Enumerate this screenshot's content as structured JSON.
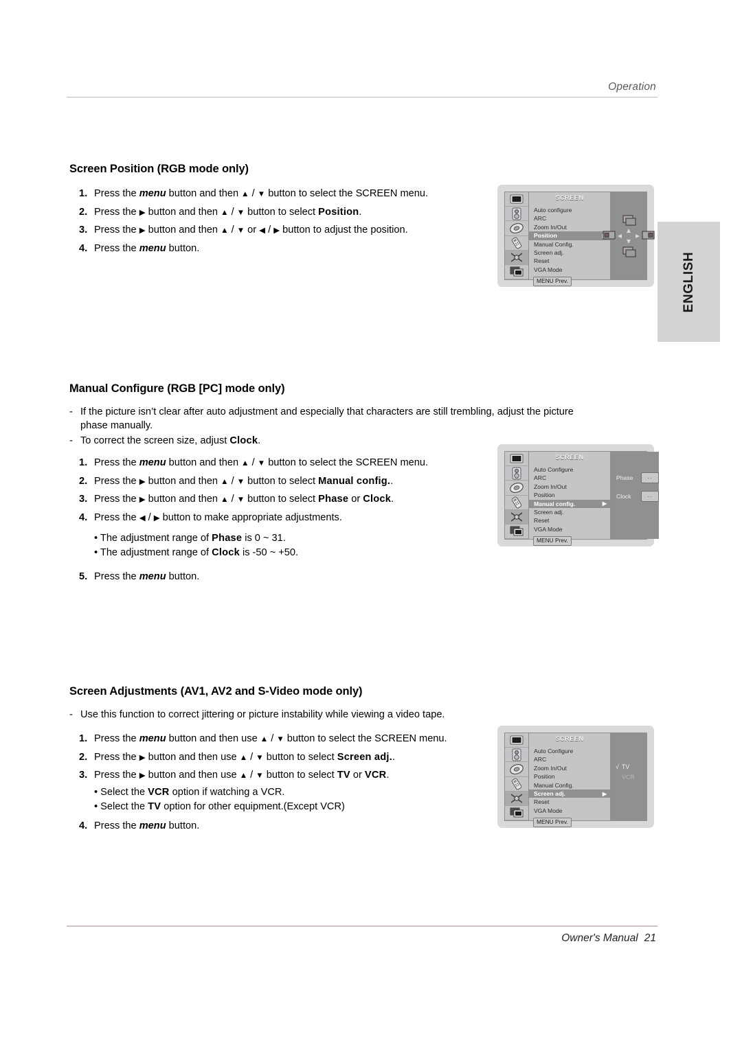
{
  "header": {
    "title": "Operation"
  },
  "side_tab": {
    "label": "ENGLISH"
  },
  "footer": {
    "label": "Owner's Manual",
    "page": "21"
  },
  "sections": [
    {
      "title": "Screen Position (RGB mode only)",
      "steps": [
        {
          "num": "1.",
          "text": "Press the menu button and then ▲ / ▼ button to select the SCREEN menu."
        },
        {
          "num": "2.",
          "text": "Press the ▶ button and then ▲ / ▼ button to select Position."
        },
        {
          "num": "3.",
          "text": "Press the ▶ button and then ▲ / ▼ or ◀ / ▶ button to adjust the position."
        },
        {
          "num": "4.",
          "text": "Press the menu button."
        }
      ]
    },
    {
      "title": "Manual Configure (RGB [PC] mode only)",
      "dashes": [
        "If the picture isn’t clear after auto adjustment and especially that characters are still trembling, adjust the picture phase manually.",
        "To correct the screen size, adjust Clock."
      ],
      "steps": [
        {
          "num": "1.",
          "text": "Press the menu button and then ▲ / ▼ button to select the SCREEN menu."
        },
        {
          "num": "2.",
          "text": "Press the ▶ button and then ▲ / ▼ button to select Manual config.."
        },
        {
          "num": "3.",
          "text": "Press the ▶ button and then ▲ / ▼ button to select Phase or Clock."
        },
        {
          "num": "4.",
          "text": "Press the ◀ / ▶ button to make appropriate adjustments."
        },
        {
          "num": "5.",
          "text": "Press the menu button."
        }
      ],
      "bullets": [
        "• The adjustment range of Phase is 0 ~ 31.",
        "• The adjustment range of Clock is -50 ~ +50."
      ]
    },
    {
      "title": "Screen Adjustments (AV1, AV2 and S-Video mode only)",
      "dashes": [
        "Use this function to correct jittering or picture instability while viewing a video tape."
      ],
      "steps": [
        {
          "num": "1.",
          "text": "Press the menu button and then use ▲ / ▼ button to select the SCREEN menu."
        },
        {
          "num": "2.",
          "text": "Press the ▶ button and then use ▲ / ▼ button to select Screen adj.."
        },
        {
          "num": "3.",
          "text": "Press the ▶ button and then use ▲ / ▼ button to select TV or VCR."
        },
        {
          "num": "4.",
          "text": "Press the menu button."
        }
      ],
      "bullets": [
        "• Select the VCR option if watching a VCR.",
        "• Select the TV option for other equipment.(Except VCR)"
      ]
    }
  ],
  "osd": [
    {
      "name": "position",
      "menu_title": "SCREEN",
      "items": [
        "Auto configure",
        "ARC",
        "Zoom In/Out",
        "Position",
        "Manual Config.",
        "Screen adj.",
        "Reset",
        "VGA Mode"
      ],
      "selected": "Position",
      "caret": "▶",
      "footer": "MENU Prev.",
      "rail_icons": [
        "picture-icon",
        "sound-icon",
        "timer-icon",
        "remote-icon",
        "screen-icon",
        "pip-icon"
      ],
      "rail_selected_index": 4,
      "pane_kind": "position-graphic"
    },
    {
      "name": "manual-config",
      "menu_title": "SCREEN",
      "items": [
        "Auto Configure",
        "ARC",
        "Zoom In/Out",
        "Position",
        "Manual config.",
        "Screen adj.",
        "Reset",
        "VGA Mode"
      ],
      "selected": "Manual config.",
      "caret": "▶",
      "footer": "MENU Prev.",
      "rail_icons": [
        "picture-icon",
        "sound-icon",
        "timer-icon",
        "remote-icon",
        "screen-icon",
        "pip-icon"
      ],
      "rail_selected_index": 4,
      "pane_kind": "value-rows",
      "pane_rows": [
        {
          "label": "Phase",
          "value": "··"
        },
        {
          "label": "Clock",
          "value": "··"
        }
      ]
    },
    {
      "name": "screen-adj",
      "menu_title": "SCREEN",
      "items": [
        "Auto Configure",
        "ARC",
        "Zoom In/Out",
        "Position",
        "Manual Config.",
        "Screen adj.",
        "Reset",
        "VGA Mode"
      ],
      "selected": "Screen adj.",
      "caret": "▶",
      "footer": "MENU Prev.",
      "rail_icons": [
        "picture-icon",
        "sound-icon",
        "timer-icon",
        "remote-icon",
        "screen-icon",
        "pip-icon"
      ],
      "rail_selected_index": 4,
      "pane_kind": "options",
      "pane_options": [
        {
          "label": "TV",
          "checked": true,
          "check": "√"
        },
        {
          "label": "VCR",
          "checked": false
        }
      ]
    }
  ],
  "colors": {
    "rule": "#b9b9b9",
    "footer_rule": "#cfc2c4",
    "tab_bg": "#d2d3d5",
    "osd_bg": "#d8d9db",
    "osd_panel": "#c3c5c7",
    "osd_pane": "#8e9092",
    "osd_highlight": "#8e9092"
  }
}
